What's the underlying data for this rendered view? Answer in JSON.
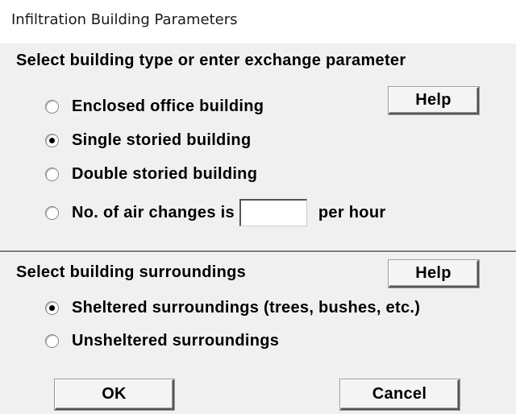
{
  "window": {
    "title": "Infiltration Building Parameters"
  },
  "building_type": {
    "heading": "Select building type or enter exchange parameter",
    "help_label": "Help",
    "options": [
      {
        "label": "Enclosed office building",
        "selected": false
      },
      {
        "label": "Single storied building",
        "selected": true
      },
      {
        "label": "Double storied building",
        "selected": false
      },
      {
        "label": "No. of air changes is",
        "selected": false
      }
    ],
    "air_changes_value": "",
    "air_changes_unit": "per hour"
  },
  "surroundings": {
    "heading": "Select building surroundings",
    "help_label": "Help",
    "options": [
      {
        "label": "Sheltered surroundings (trees, bushes, etc.)",
        "selected": true
      },
      {
        "label": "Unsheltered surroundings",
        "selected": false
      }
    ]
  },
  "buttons": {
    "ok_label": "OK",
    "cancel_label": "Cancel"
  }
}
